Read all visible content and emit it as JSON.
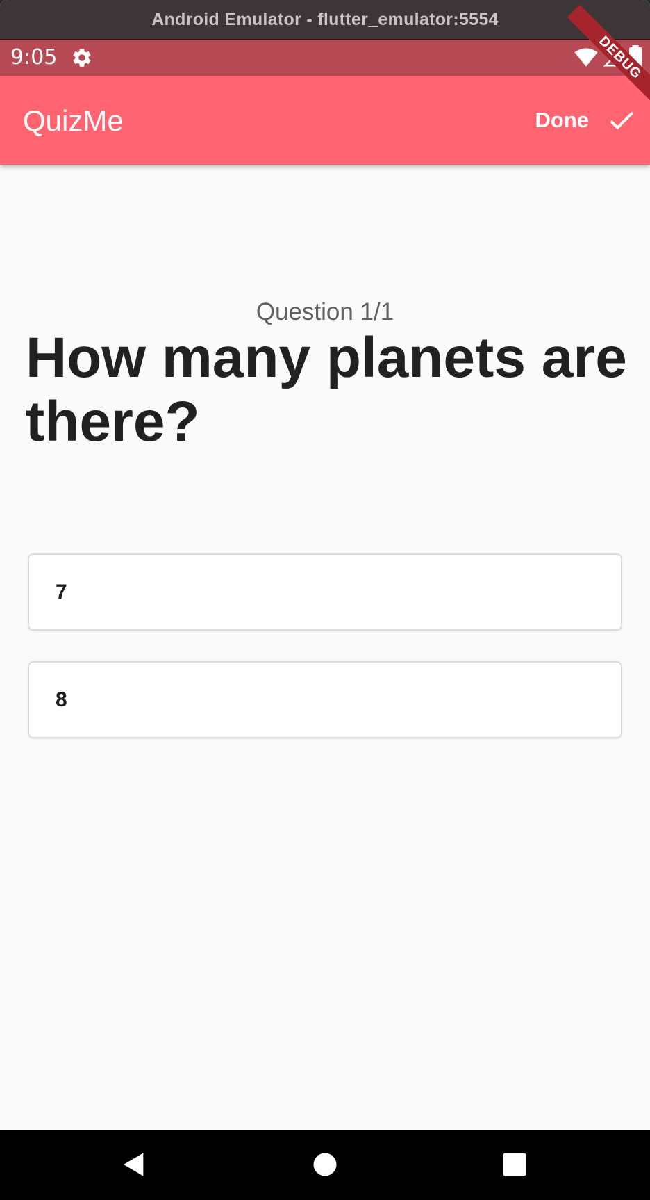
{
  "window": {
    "title": "Android Emulator - flutter_emulator:5554"
  },
  "status_bar": {
    "time": "9:05",
    "left_icon": "gear-icon",
    "right_icons": [
      "wifi-icon",
      "cellular-signal-icon",
      "battery-icon"
    ],
    "color": "#b84a55"
  },
  "app_bar": {
    "title": "QuizMe",
    "action_label": "Done",
    "action_icon": "check-icon",
    "color": "#ff6470"
  },
  "debug_banner": {
    "label": "DEBUG",
    "color": "#a6242c"
  },
  "quiz": {
    "counter": "Question 1/1",
    "question": "How many planets are there?",
    "answers": [
      {
        "label": "7"
      },
      {
        "label": "8"
      }
    ]
  },
  "nav_bar": {
    "buttons": [
      "back-icon",
      "home-icon",
      "recents-icon"
    ]
  }
}
